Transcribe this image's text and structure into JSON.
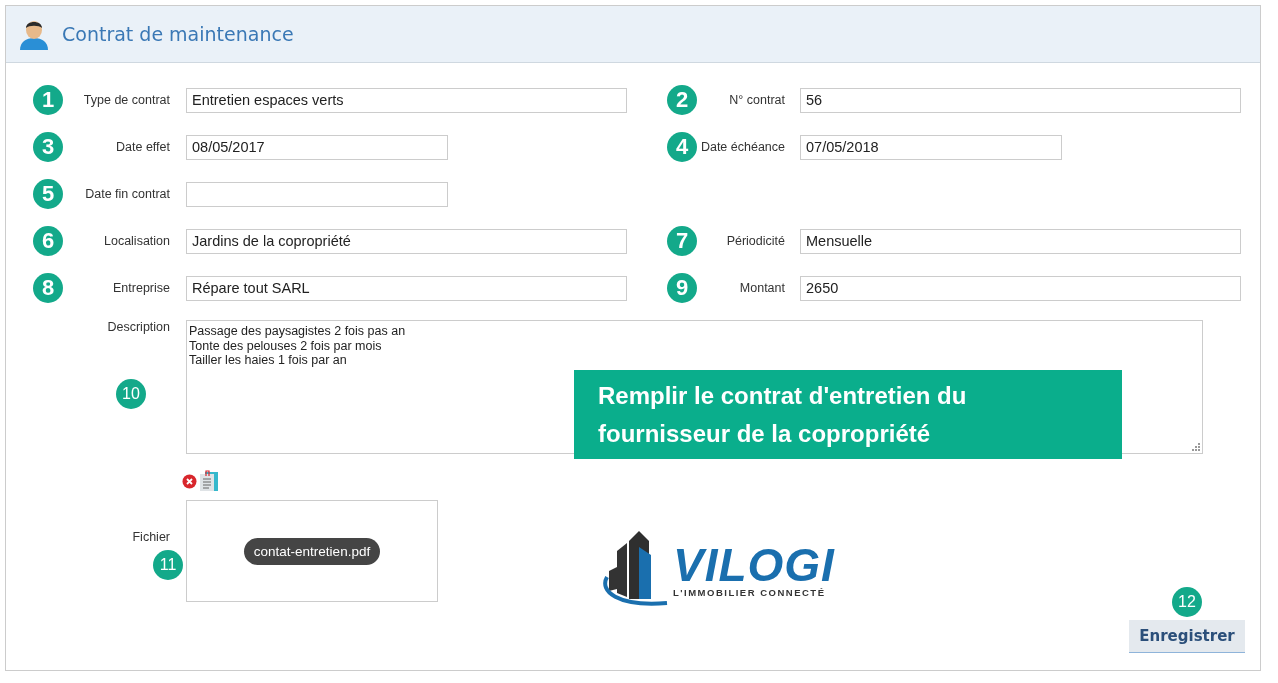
{
  "header": {
    "title": "Contrat de maintenance"
  },
  "rows": [
    {
      "fields": [
        {
          "number": "1",
          "label": "Type de contrat",
          "value": "Entretien espaces verts",
          "kind": "text"
        },
        {
          "number": "2",
          "label": "N° contrat",
          "value": "56",
          "kind": "text"
        }
      ]
    },
    {
      "fields": [
        {
          "number": "3",
          "label": "Date effet",
          "value": "08/05/2017",
          "kind": "date"
        },
        {
          "number": "4",
          "label": "Date échéance",
          "value": "07/05/2018",
          "kind": "date"
        }
      ]
    },
    {
      "fields": [
        {
          "number": "5",
          "label": "Date fin contrat",
          "kind": "date"
        }
      ]
    },
    {
      "fields": [
        {
          "number": "6",
          "label": "Localisation",
          "value": "Jardins de la copropriété",
          "kind": "text"
        },
        {
          "number": "7",
          "label": "Périodicité",
          "value": "Mensuelle",
          "kind": "text"
        }
      ]
    },
    {
      "fields": [
        {
          "number": "8",
          "label": "Entreprise",
          "value": "Répare tout SARL",
          "kind": "text"
        },
        {
          "number": "9",
          "label": "Montant",
          "value": "2650",
          "kind": "text"
        }
      ]
    }
  ],
  "description": {
    "label": "Description",
    "number": "10",
    "lines": [
      "Passage des paysagistes 2 fois pas an",
      "Tonte des pelouses 2 fois par mois",
      "Tailler les haies 1 fois par an"
    ]
  },
  "callout": {
    "text": "Remplir le contrat d'entretien du fournisseur de la copropriété"
  },
  "file": {
    "label": "Fichier",
    "number": "11",
    "filename": "contat-entretien.pdf"
  },
  "logo": {
    "name": "VILOGI",
    "tagline": "L'IMMOBILIER CONNECTÉ"
  },
  "save": {
    "number": "12",
    "label": "Enregistrer"
  }
}
